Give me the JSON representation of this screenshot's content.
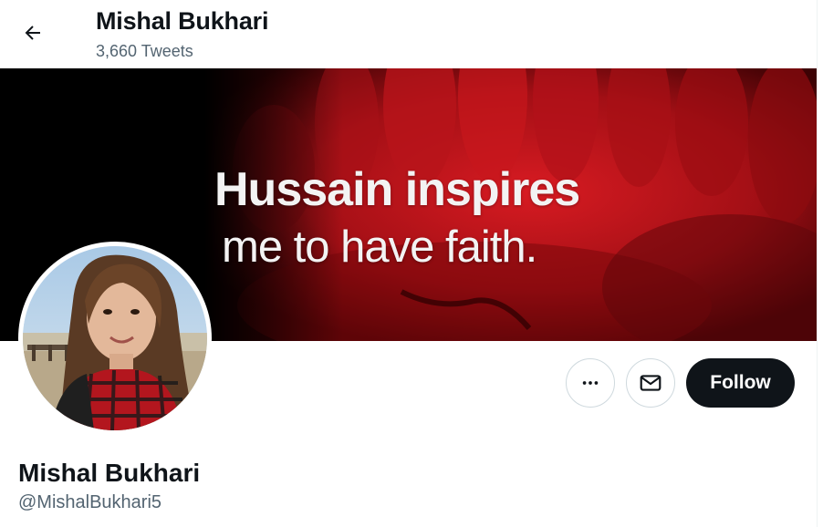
{
  "header": {
    "name": "Mishal Bukhari",
    "tweet_count": "3,660 Tweets",
    "back_icon": "arrow-left-icon"
  },
  "banner": {
    "line1": "Hussain inspires",
    "line2": "me to have faith.",
    "colors": {
      "background": "#000000",
      "red": "#c4161c",
      "dark_red": "#5a0508"
    }
  },
  "profile": {
    "name": "Mishal Bukhari",
    "handle": "@MishalBukhari5",
    "avatar_icon": "profile-photo"
  },
  "actions": {
    "more_icon": "more-horizontal-icon",
    "message_icon": "envelope-icon",
    "follow_label": "Follow"
  },
  "colors": {
    "text_primary": "#0f1419",
    "text_secondary": "#536471",
    "border": "#cfd9de",
    "follow_bg": "#0f1419"
  }
}
